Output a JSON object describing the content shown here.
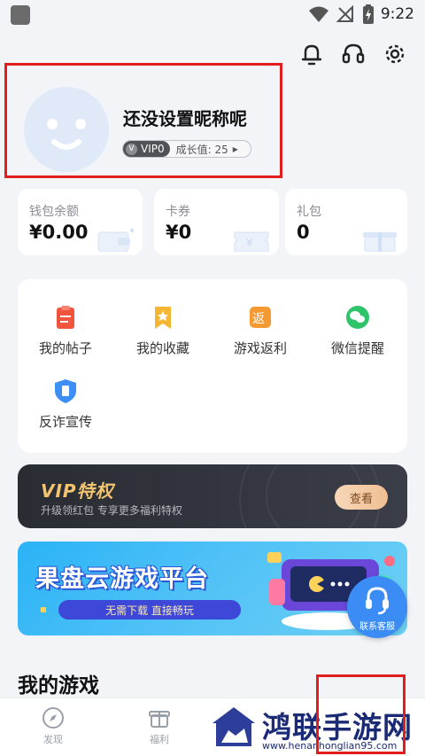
{
  "status_bar": {
    "time": "9:22"
  },
  "profile": {
    "nickname": "还没设置昵称呢",
    "vip_level": "VIP0",
    "vip_badge_letter": "V",
    "growth": "成长值: 25"
  },
  "wallet": [
    {
      "label": "钱包余额",
      "value": "¥0.00"
    },
    {
      "label": "卡券",
      "value": "¥0"
    },
    {
      "label": "礼包",
      "value": "0"
    }
  ],
  "menu": [
    {
      "label": "我的帖子",
      "icon": "clipboard-icon",
      "color": "#f2553e"
    },
    {
      "label": "我的收藏",
      "icon": "bookmark-star-icon",
      "color": "#f5b733"
    },
    {
      "label": "游戏返利",
      "icon": "rebate-icon",
      "color": "#f59a32",
      "glyph": "返"
    },
    {
      "label": "微信提醒",
      "icon": "wechat-icon",
      "color": "#2fc36a"
    },
    {
      "label": "反诈宣传",
      "icon": "shield-phone-icon",
      "color": "#3d8ef5"
    }
  ],
  "vip_banner": {
    "title": "VIP特权",
    "subtitle": "升级领红包 专享更多福利特权",
    "button": "查看"
  },
  "cloud_banner": {
    "title": "果盘云游戏平台",
    "subtitle": "无需下载  直接畅玩"
  },
  "service": {
    "label": "联系客服"
  },
  "section": {
    "my_games": "我的游戏"
  },
  "bottom_nav": [
    {
      "label": "发现",
      "icon": "compass-icon"
    },
    {
      "label": "福利",
      "icon": "gift-box-icon"
    }
  ],
  "watermark": {
    "text": "鸿联手游网",
    "url": "www.henanhonglian95.com"
  },
  "colors": {
    "accent_red": "#e11d1d",
    "vip_gold": "#f3c46f",
    "banner_blue": "#2ab3f6"
  }
}
